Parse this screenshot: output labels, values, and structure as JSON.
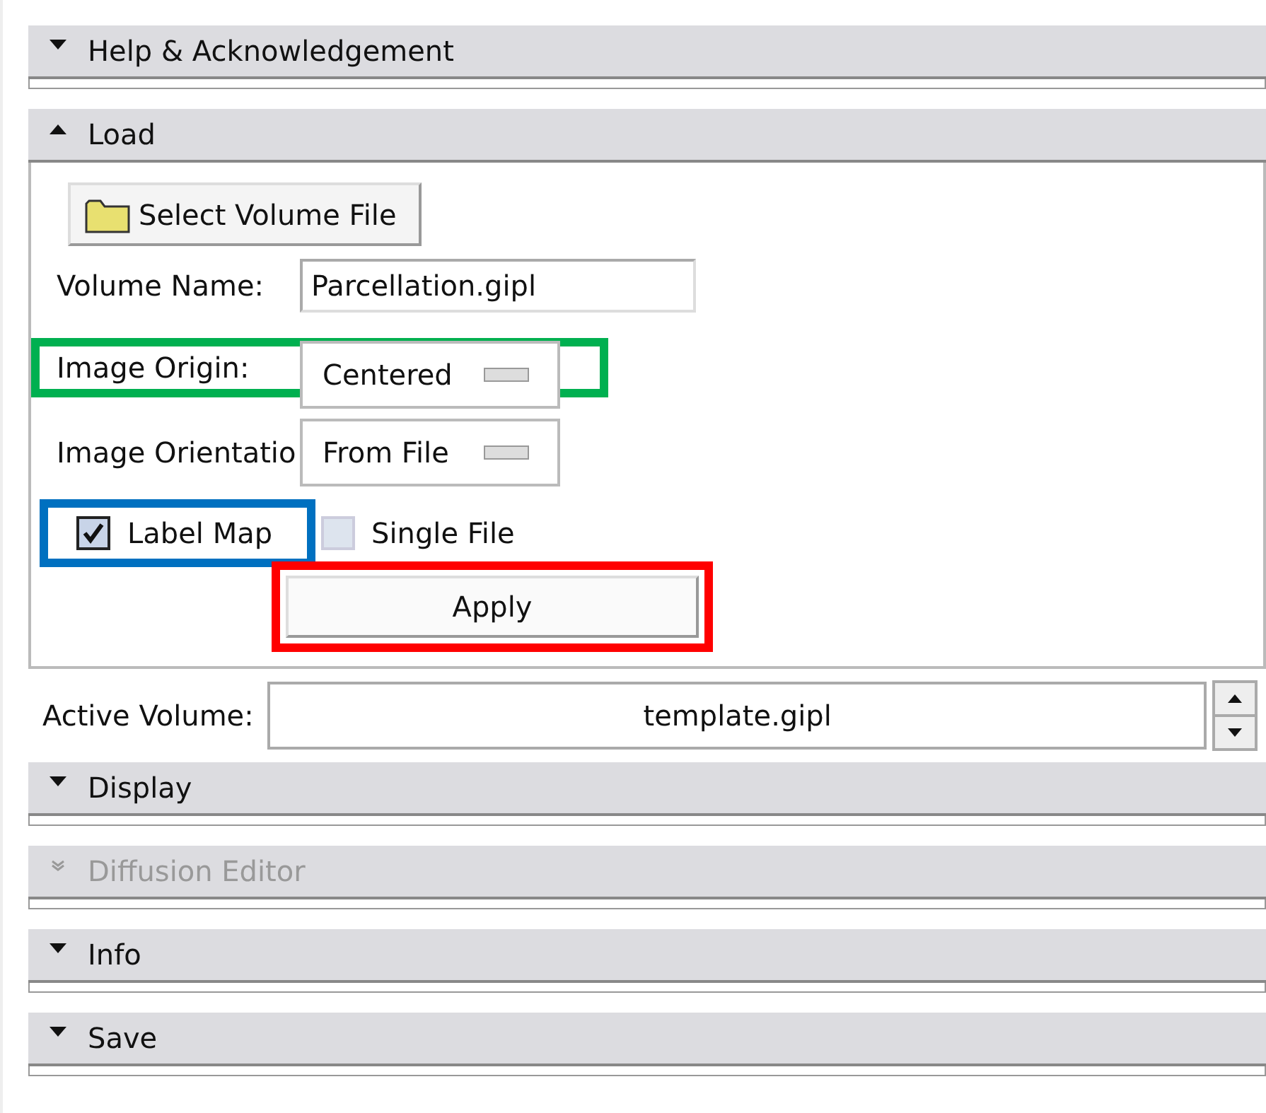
{
  "sections_top": [
    {
      "title": "Help & Acknowledgement",
      "expanded": false,
      "disabled": false
    }
  ],
  "load": {
    "title": "Load",
    "expanded": true,
    "select_button": "Select Volume File",
    "volume_name": {
      "label": "Volume Name:",
      "value": "Parcellation.gipl"
    },
    "image_origin": {
      "label": "Image Origin:",
      "value": "Centered"
    },
    "image_orientation": {
      "label": "Image Orientatio",
      "value": "From File"
    },
    "checkboxes": [
      {
        "label": "Label Map",
        "checked": true
      },
      {
        "label": "Single File",
        "checked": false
      }
    ],
    "apply": {
      "label": "Apply"
    },
    "annotation_frames": [
      {
        "color": "#00b050"
      },
      {
        "color": "#0070c0"
      },
      {
        "color": "#ff0000"
      }
    ]
  },
  "active_volume": {
    "label": "Active Volume:",
    "value": "template.gipl"
  },
  "sections_bottom": [
    {
      "title": "Display",
      "expanded": false,
      "disabled": false
    },
    {
      "title": "Diffusion Editor",
      "expanded": false,
      "disabled": true
    },
    {
      "title": "Info",
      "expanded": false,
      "disabled": false
    },
    {
      "title": "Save",
      "expanded": false,
      "disabled": false
    }
  ]
}
